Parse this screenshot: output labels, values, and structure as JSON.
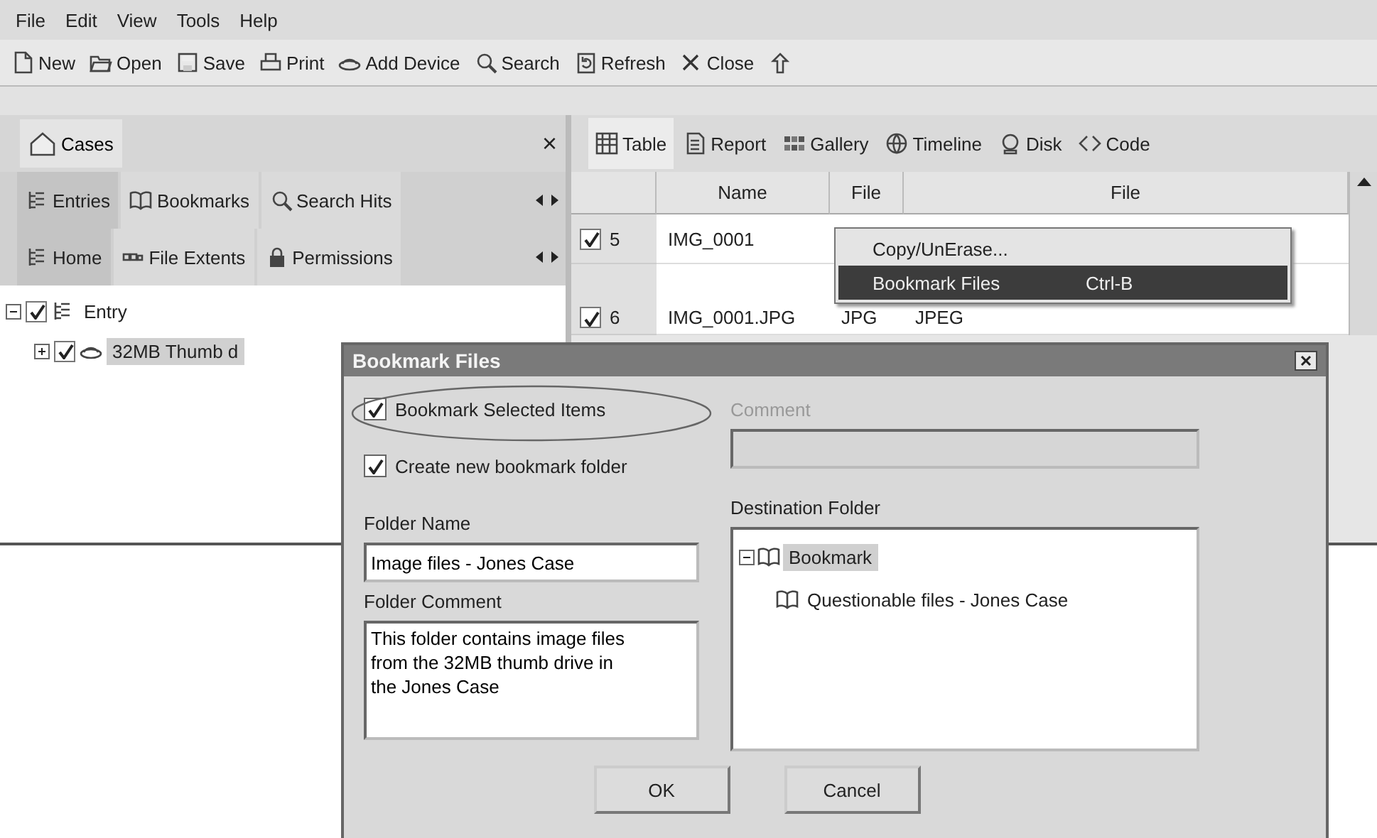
{
  "menu_bar": [
    "File",
    "Edit",
    "View",
    "Tools",
    "Help"
  ],
  "toolbar": [
    {
      "kind": "new",
      "label": "New"
    },
    {
      "kind": "open",
      "label": "Open"
    },
    {
      "kind": "save",
      "label": "Save"
    },
    {
      "kind": "print",
      "label": "Print"
    },
    {
      "kind": "device",
      "label": "Add Device"
    },
    {
      "kind": "search",
      "label": "Search"
    },
    {
      "kind": "refresh",
      "label": "Refresh"
    },
    {
      "kind": "close",
      "label": "Close"
    },
    {
      "kind": "up"
    }
  ],
  "left_pane": {
    "title": "Cases",
    "close": "×",
    "tabs": [
      {
        "kind": "tree",
        "label": "Entries",
        "selected": true
      },
      {
        "kind": "book",
        "label": "Bookmarks",
        "selected": false
      },
      {
        "kind": "search",
        "label": "Search Hits",
        "selected": false
      }
    ],
    "subtabs": [
      {
        "kind": "tree",
        "label": "Home",
        "selected": true
      },
      {
        "kind": "extents",
        "label": "File Extents",
        "selected": false
      },
      {
        "kind": "lock",
        "label": "Permissions",
        "selected": false
      }
    ],
    "tree": [
      {
        "label": "Entry",
        "kind": "tree",
        "checked": true,
        "expanded": true,
        "selected": false,
        "children": [
          {
            "label": "32MB Thumb d",
            "kind": "device",
            "checked": true,
            "expanded": false,
            "selected": true
          }
        ]
      }
    ]
  },
  "right_pane": {
    "views": [
      {
        "kind": "table",
        "label": "Table",
        "selected": true
      },
      {
        "kind": "report",
        "label": "Report",
        "selected": false
      },
      {
        "kind": "gallery",
        "label": "Gallery",
        "selected": false
      },
      {
        "kind": "timeline",
        "label": "Timeline",
        "selected": false
      },
      {
        "kind": "disk",
        "label": "Disk",
        "selected": false
      },
      {
        "kind": "code",
        "label": "Code",
        "selected": false
      }
    ],
    "table": {
      "columns": [
        "Name",
        "File",
        "File"
      ],
      "rows": [
        {
          "checked": true,
          "index": "5",
          "cells": [
            "IMG_0001",
            "",
            ""
          ]
        },
        {
          "checked": true,
          "index": "6",
          "cells": [
            "IMG_0001.JPG",
            "JPG",
            "JPEG"
          ]
        }
      ]
    }
  },
  "context_menu": {
    "items": [
      {
        "label": "Copy/UnErase...",
        "selected": false
      },
      {
        "label": "Bookmark Files",
        "shortcut": "Ctrl-B",
        "selected": true
      }
    ]
  },
  "dialog": {
    "title": "Bookmark Files",
    "checkboxes": [
      {
        "label": "Bookmark Selected Items",
        "checked": true
      },
      {
        "label": "Create new bookmark folder",
        "checked": true
      }
    ],
    "comment": {
      "label": "Comment",
      "disabled": true
    },
    "folder_name": {
      "label": "Folder Name",
      "value": "Image files - Jones Case"
    },
    "folder_comment": {
      "label": "Folder Comment",
      "value": "This folder contains image files from the 32MB thumb drive in the Jones Case"
    },
    "destination": {
      "label": "Destination Folder",
      "tree": [
        {
          "label": "Bookmark",
          "expanded": true,
          "selected": true,
          "children": [
            {
              "label": "Questionable files - Jones Case",
              "selected": false
            }
          ]
        }
      ]
    },
    "buttons": [
      "OK",
      "Cancel"
    ]
  }
}
